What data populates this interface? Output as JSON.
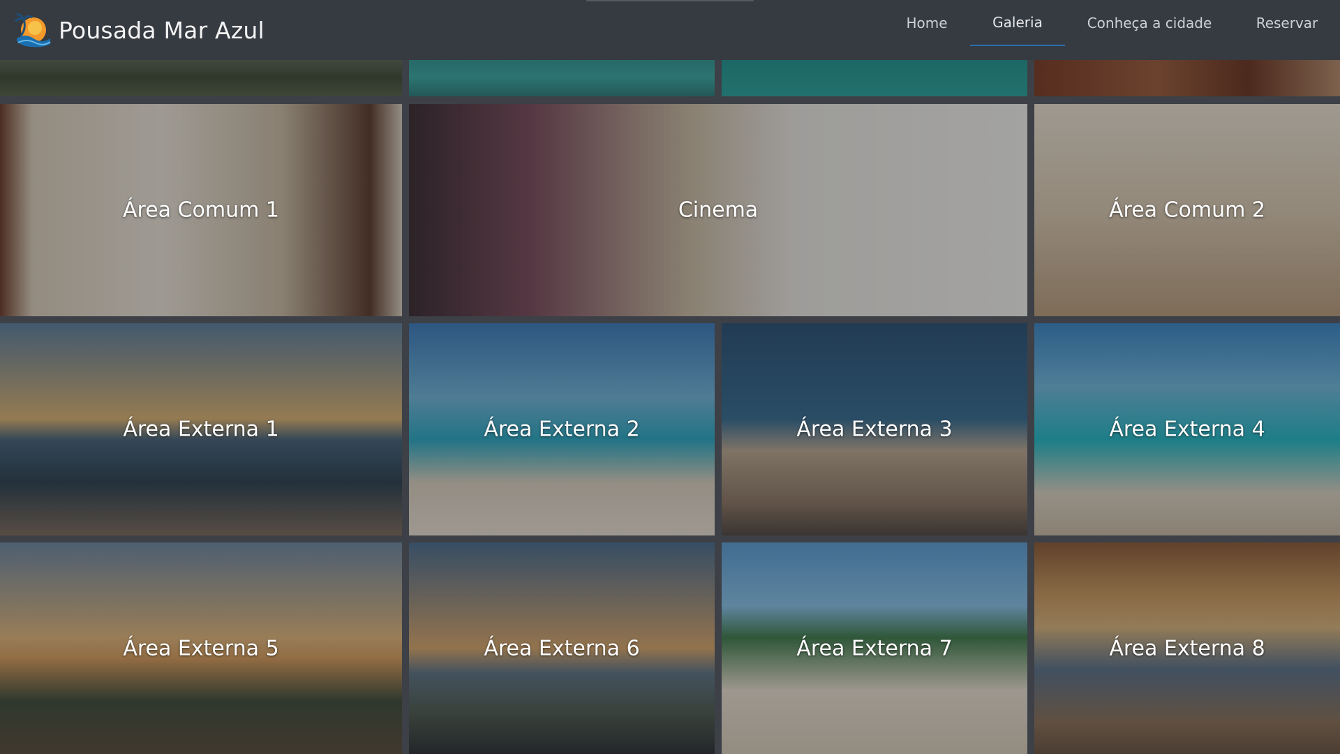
{
  "app": {
    "brand_name": "Pousada Mar Azul",
    "logo_icon": "sun-palm-wave-logo"
  },
  "nav": {
    "items": [
      {
        "label": "Home",
        "active": false
      },
      {
        "label": "Galeria",
        "active": true
      },
      {
        "label": "Conheça a cidade",
        "active": false
      },
      {
        "label": "Reservar",
        "active": false
      }
    ],
    "active_underline_color": "#2b6cb0"
  },
  "gallery": {
    "rows": [
      {
        "tiles": [
          {
            "label": "Área Comum 1"
          },
          {
            "label": "Cinema"
          },
          {
            "label": "Área Comum 2"
          }
        ]
      },
      {
        "tiles": [
          {
            "label": "Área Externa 1"
          },
          {
            "label": "Área Externa 2"
          },
          {
            "label": "Área Externa 3"
          },
          {
            "label": "Área Externa 4"
          }
        ]
      },
      {
        "tiles": [
          {
            "label": "Área Externa 5"
          },
          {
            "label": "Área Externa 6"
          },
          {
            "label": "Área Externa 7"
          },
          {
            "label": "Área Externa 8"
          }
        ]
      }
    ]
  },
  "colors": {
    "navbar_bg": "#363a41",
    "page_bg": "#3d4046",
    "text_light": "#f3f3f3"
  }
}
